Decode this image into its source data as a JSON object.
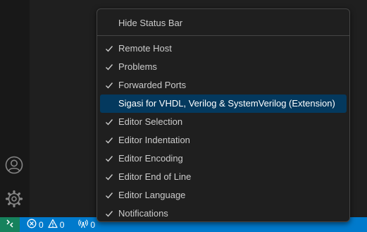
{
  "menu": {
    "top_item": "Hide Status Bar",
    "items": [
      {
        "label": "Remote Host",
        "checked": true
      },
      {
        "label": "Problems",
        "checked": true
      },
      {
        "label": "Forwarded Ports",
        "checked": true
      },
      {
        "label": "Sigasi for VHDL, Verilog & SystemVerilog (Extension)",
        "checked": false,
        "selected": true
      },
      {
        "label": "Editor Selection",
        "checked": true
      },
      {
        "label": "Editor Indentation",
        "checked": true
      },
      {
        "label": "Editor Encoding",
        "checked": true
      },
      {
        "label": "Editor End of Line",
        "checked": true
      },
      {
        "label": "Editor Language",
        "checked": true
      },
      {
        "label": "Notifications",
        "checked": true
      }
    ]
  },
  "status_bar": {
    "errors": "0",
    "warnings": "0",
    "ports": "0"
  },
  "colors": {
    "status_bar": "#007acc",
    "remote_indicator": "#16825d",
    "menu_selection": "#04395e",
    "menu_background": "#1f1f1f"
  },
  "icons": {
    "remote": "remote-icon",
    "error": "error-icon",
    "warning": "warning-icon",
    "ports": "radio-tower-icon",
    "accounts": "account-icon",
    "manage": "gear-icon",
    "check": "check-icon"
  }
}
